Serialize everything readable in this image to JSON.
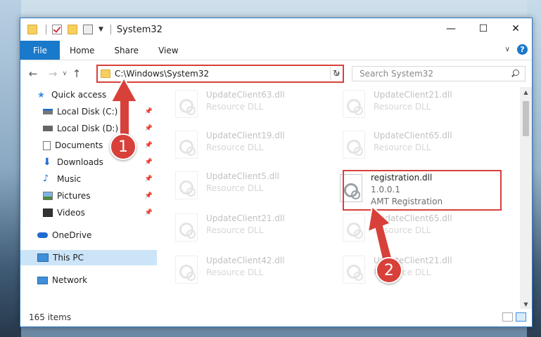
{
  "window": {
    "title": "System32",
    "minimize": "—",
    "maximize": "☐",
    "close": "✕"
  },
  "ribbon": {
    "tabs": [
      "File",
      "Home",
      "Share",
      "View"
    ],
    "help": "?"
  },
  "nav": {
    "back": "←",
    "forward": "→",
    "up": "↑",
    "address": "C:\\Windows\\System32",
    "search_placeholder": "Search System32"
  },
  "sidebar": {
    "items": [
      {
        "label": "Quick access",
        "icon": "star-icon",
        "pinned": false
      },
      {
        "label": "Local Disk (C:)",
        "icon": "drive-icon",
        "pinned": true
      },
      {
        "label": "Local Disk (D:)",
        "icon": "drive-icon",
        "pinned": true
      },
      {
        "label": "Documents",
        "icon": "documents-icon",
        "pinned": true
      },
      {
        "label": "Downloads",
        "icon": "download-icon",
        "pinned": true
      },
      {
        "label": "Music",
        "icon": "music-icon",
        "pinned": true
      },
      {
        "label": "Pictures",
        "icon": "pictures-icon",
        "pinned": true
      },
      {
        "label": "Videos",
        "icon": "videos-icon",
        "pinned": true
      },
      {
        "label": "OneDrive",
        "icon": "cloud-icon",
        "pinned": false
      },
      {
        "label": "This PC",
        "icon": "computer-icon",
        "pinned": false,
        "selected": true
      },
      {
        "label": "Network",
        "icon": "network-icon",
        "pinned": false
      }
    ]
  },
  "files": [
    {
      "name": "UpdateClient63.dll",
      "sub": "Resource DLL",
      "faded": true
    },
    {
      "name": "UpdateClient21.dll",
      "sub": "Resource DLL",
      "faded": true
    },
    {
      "name": "UpdateClient19.dll",
      "sub": "Resource DLL",
      "faded": true
    },
    {
      "name": "UpdateClient65.dll",
      "sub": "Resource DLL",
      "faded": true
    },
    {
      "name": "UpdateClient5.dll",
      "sub": "Resource DLL",
      "faded": true
    },
    {
      "name": "registration.dll",
      "sub": "1.0.0.1",
      "sub2": "AMT Registration",
      "faded": false
    },
    {
      "name": "UpdateClient21.dll",
      "sub": "Resource DLL",
      "faded": true
    },
    {
      "name": "UpdateClient65.dll",
      "sub": "Resource DLL",
      "faded": true
    },
    {
      "name": "UpdateClient42.dll",
      "sub": "Resource DLL",
      "faded": true
    },
    {
      "name": "UpdateClient21.dll",
      "sub": "Resource DLL",
      "faded": true
    }
  ],
  "status": {
    "item_count": "165 items"
  },
  "annotations": {
    "step1": "1",
    "step2": "2",
    "color": "#d8403a"
  }
}
